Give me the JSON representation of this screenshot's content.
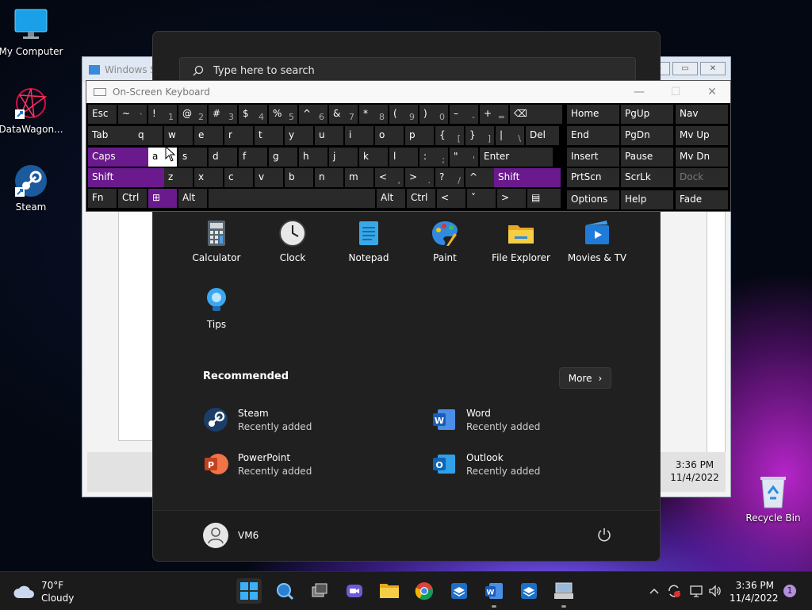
{
  "desktop": {
    "icons": [
      {
        "label": "My Computer"
      },
      {
        "label": "DataWagon..."
      },
      {
        "label": "Steam"
      },
      {
        "label": "Recycle Bin"
      }
    ]
  },
  "background_window": {
    "title": "Windows Se",
    "clock_time": "3:36 PM",
    "clock_date": "11/4/2022"
  },
  "start_menu": {
    "search_placeholder": "Type here to search",
    "pinned": [
      {
        "label": "Calculator",
        "icon": "calculator-icon"
      },
      {
        "label": "Clock",
        "icon": "clock-icon"
      },
      {
        "label": "Notepad",
        "icon": "notepad-icon"
      },
      {
        "label": "Paint",
        "icon": "paint-icon"
      },
      {
        "label": "File Explorer",
        "icon": "folder-icon"
      },
      {
        "label": "Movies & TV",
        "icon": "movies-icon"
      },
      {
        "label": "Tips",
        "icon": "lightbulb-icon"
      }
    ],
    "recommended_title": "Recommended",
    "more_label": "More",
    "recommended": [
      {
        "name": "Steam",
        "sub": "Recently added"
      },
      {
        "name": "Word",
        "sub": "Recently added"
      },
      {
        "name": "PowerPoint",
        "sub": "Recently added"
      },
      {
        "name": "Outlook",
        "sub": "Recently added"
      }
    ],
    "user_name": "VM6"
  },
  "osk": {
    "title": "On-Screen Keyboard",
    "row1": [
      "Esc",
      "~",
      "!",
      "@",
      "#",
      "$",
      "%",
      "^",
      "&",
      "*",
      "(",
      ")",
      "–",
      "+"
    ],
    "row1_sub": [
      "",
      "`",
      "1",
      "2",
      "3",
      "4",
      "5",
      "6",
      "7",
      "8",
      "9",
      "0",
      "-",
      "="
    ],
    "row2": [
      "Tab",
      "q",
      "w",
      "e",
      "r",
      "t",
      "y",
      "u",
      "i",
      "o",
      "p",
      "{",
      "}",
      "|",
      "Del"
    ],
    "row2_sub": [
      "",
      "",
      "",
      "",
      "",
      "",
      "",
      "",
      "",
      "",
      "",
      "[",
      "]",
      "\\",
      ""
    ],
    "row3": [
      "Caps",
      "a",
      "s",
      "d",
      "f",
      "g",
      "h",
      "j",
      "k",
      "l",
      ":",
      "\"",
      "Enter"
    ],
    "row3_sub": [
      "",
      "",
      "",
      "",
      "",
      "",
      "",
      "",
      "",
      "",
      ";",
      "'",
      ""
    ],
    "row4": [
      "Shift",
      "z",
      "x",
      "c",
      "v",
      "b",
      "n",
      "m",
      "<",
      ">",
      "?",
      "Shift"
    ],
    "row4_sub": [
      "",
      "",
      "",
      "",
      "",
      "",
      "",
      "",
      ",",
      ".",
      "/",
      ""
    ],
    "row5": [
      "Fn",
      "Ctrl",
      "Alt",
      "Alt",
      "Ctrl"
    ],
    "nav": [
      [
        "Home",
        "PgUp",
        "Nav"
      ],
      [
        "End",
        "PgDn",
        "Mv Up"
      ],
      [
        "Insert",
        "Pause",
        "Mv Dn"
      ],
      [
        "PrtScn",
        "ScrLk",
        "Dock"
      ],
      [
        "Options",
        "Help",
        "Fade"
      ]
    ]
  },
  "taskbar": {
    "weather_temp": "70°F",
    "weather_desc": "Cloudy",
    "time": "3:36 PM",
    "date": "11/4/2022",
    "notification_count": "1"
  }
}
